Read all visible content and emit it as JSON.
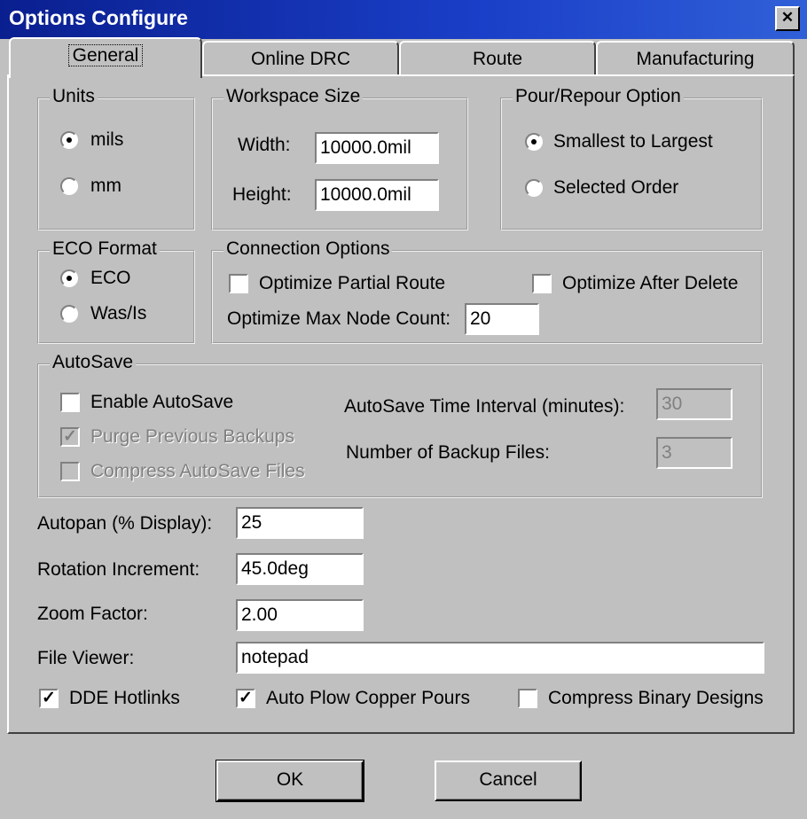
{
  "window": {
    "title": "Options Configure",
    "close_glyph": "✕"
  },
  "tabs": [
    "General",
    "Online DRC",
    "Route",
    "Manufacturing"
  ],
  "units": {
    "title": "Units",
    "options": [
      "mils",
      "mm"
    ],
    "selected": "mils"
  },
  "workspace": {
    "title": "Workspace Size",
    "width_label": "Width:",
    "width_value": "10000.0mil",
    "height_label": "Height:",
    "height_value": "10000.0mil"
  },
  "pour": {
    "title": "Pour/Repour Option",
    "options": [
      "Smallest to Largest",
      "Selected Order"
    ],
    "selected": "Smallest to Largest"
  },
  "eco": {
    "title": "ECO Format",
    "options": [
      "ECO",
      "Was/Is"
    ],
    "selected": "ECO"
  },
  "connection": {
    "title": "Connection Options",
    "partial_route_label": "Optimize Partial Route",
    "partial_route_checked": false,
    "after_delete_label": "Optimize After Delete",
    "after_delete_checked": false,
    "max_node_label": "Optimize Max Node Count:",
    "max_node_value": "20"
  },
  "autosave": {
    "title": "AutoSave",
    "enable_label": "Enable AutoSave",
    "enable_checked": false,
    "purge_label": "Purge Previous Backups",
    "purge_checked": true,
    "compress_label": "Compress AutoSave Files",
    "compress_checked": false,
    "interval_label": "AutoSave Time Interval (minutes):",
    "interval_value": "30",
    "backup_label": "Number of Backup Files:",
    "backup_value": "3"
  },
  "fields": {
    "autopan_label": "Autopan (% Display):",
    "autopan_value": "25",
    "rotation_label": "Rotation Increment:",
    "rotation_value": "45.0deg",
    "zoom_label": "Zoom Factor:",
    "zoom_value": "2.00",
    "viewer_label": "File Viewer:",
    "viewer_value": "notepad"
  },
  "bottom_checks": {
    "dde_label": "DDE Hotlinks",
    "dde_checked": true,
    "plow_label": "Auto Plow Copper Pours",
    "plow_checked": true,
    "binary_label": "Compress Binary Designs",
    "binary_checked": false
  },
  "buttons": {
    "ok": "OK",
    "cancel": "Cancel"
  },
  "check_glyph": "✓"
}
